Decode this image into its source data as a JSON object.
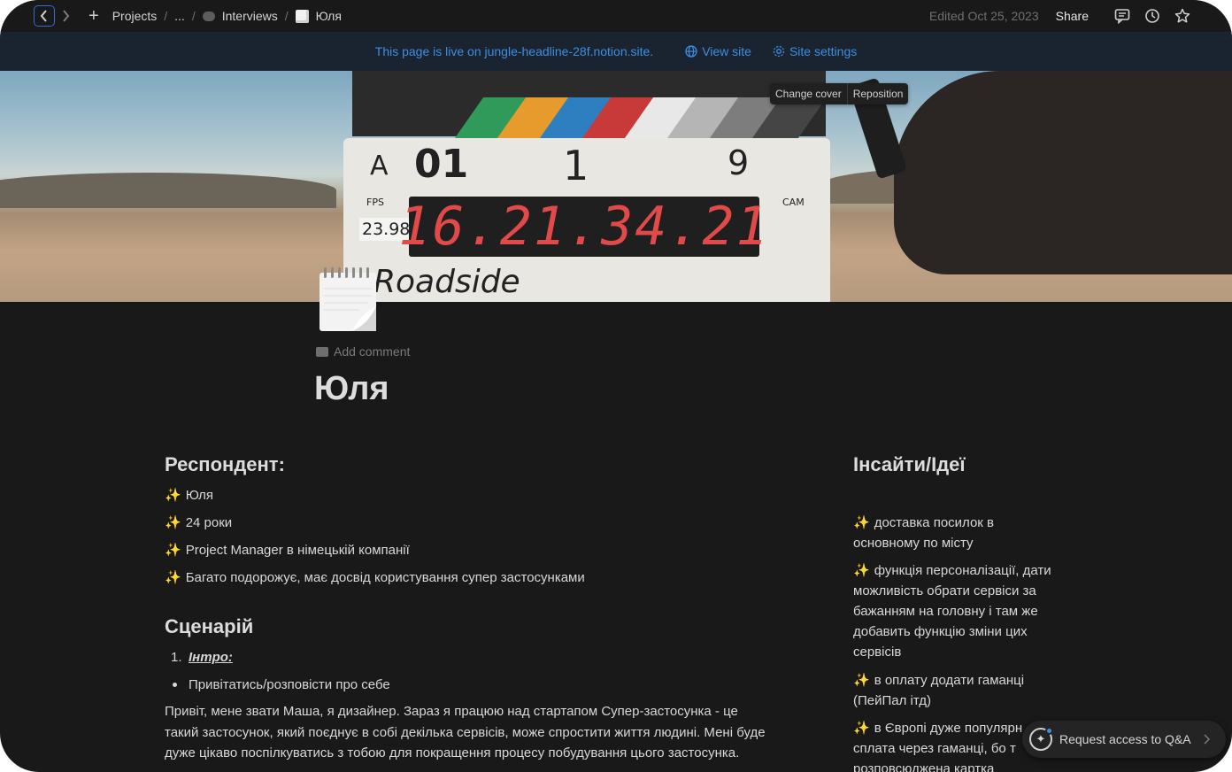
{
  "breadcrumb": {
    "items": [
      "Projects",
      "...",
      "Interviews",
      "Юля"
    ],
    "separator": "/"
  },
  "topbar": {
    "edited": "Edited Oct 25, 2023",
    "share_label": "Share"
  },
  "banner": {
    "live_text": "This page is live on jungle-headline-28f.notion.site.",
    "view_site": "View site",
    "site_settings": "Site settings"
  },
  "cover": {
    "change_cover": "Change cover",
    "reposition": "Reposition"
  },
  "page": {
    "add_comment": "Add comment",
    "title": "Юля"
  },
  "left_column": {
    "respondent_heading": "Респондент:",
    "respondent_items": [
      "Юля",
      "24 роки",
      "Project Manager в німецькій компанії",
      "Багато подорожує, має досвід користування супер застосунками"
    ],
    "scenario_heading": "Сценарій",
    "scenario_number": "1.",
    "scenario_intro": "Інтро:",
    "scenario_bullet": "Привітатись/розповісти про себе",
    "scenario_paragraph_lines": [
      "Привіт, мене звати Маша, я дизайнер. Зараз я працюю над стартапом Супер-застосунка - це",
      "такий застосунок, який поєднує в собі декілька сервісів, може спростити життя людині. Мені буде",
      "дуже цікаво поспілкуватись з тобою для покращення процесу побудування цього застосунка."
    ]
  },
  "right_column": {
    "heading": "Інсайти/Ідеї",
    "items": [
      [
        "доставка посилок в",
        "основному по місту"
      ],
      [
        "функція персоналізації, дати",
        "можливість обрати сервіси за",
        "бажанням на головну і там же",
        "добавить функцію зміни цих",
        "сервісів"
      ],
      [
        "в оплату додати гаманці",
        "(ПейПал ітд)"
      ],
      [
        "в Європі дуже популярн",
        "сплата через гаманці, бо т",
        "розповсюджена картка"
      ]
    ]
  },
  "request": {
    "label": "Request access to Q&A"
  },
  "colors": {
    "background": "#191919",
    "banner_bg": "#1a2330",
    "link_blue": "#3d8ee3",
    "sparkle": "#e8b93a"
  },
  "icons": {
    "sparkle": "✨",
    "back": "chevron-left-icon",
    "forward": "chevron-right-icon"
  }
}
